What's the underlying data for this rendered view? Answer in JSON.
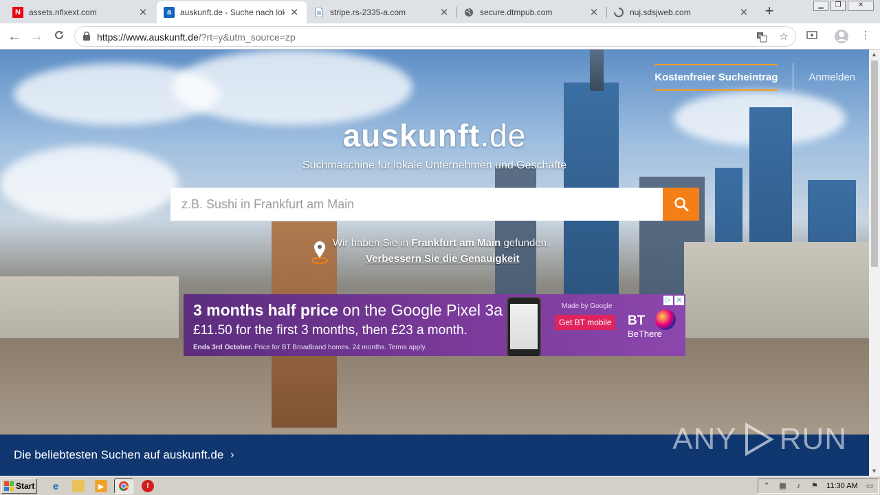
{
  "browser": {
    "tabs": [
      {
        "title": "assets.nflxext.com",
        "favicon": "netflix-icon",
        "active": false
      },
      {
        "title": "auskunft.de - Suche nach lokale",
        "favicon": "auskunft-icon",
        "active": true
      },
      {
        "title": "stripe.rs-2335-a.com",
        "favicon": "document-icon",
        "active": false
      },
      {
        "title": "secure.dtmpub.com",
        "favicon": "globe-icon",
        "active": false
      },
      {
        "title": "nuj.sdsjweb.com",
        "favicon": "loading-icon",
        "active": false
      }
    ],
    "url_host": "https://www.auskunft.de",
    "url_rest": "/?rt=y&utm_source=zp"
  },
  "page": {
    "free_entry": "Kostenfreier Sucheintrag",
    "login": "Anmelden",
    "logo_bold": "auskunft",
    "logo_tld": ".de",
    "tagline": "Suchmaschine für lokale Unternehmen und Geschäfte",
    "search_placeholder": "z.B. Sushi in Frankfurt am Main",
    "location_prefix": "Wir haben Sie in",
    "location_city": "Frankfurt am Main",
    "location_suffix": "gefunden.",
    "improve_accuracy": "Verbessern Sie die Genauigkeit",
    "popular_searches": "Die beliebtesten Suchen auf auskunft.de",
    "accent_color": "#f57f17",
    "band_color": "#10366f"
  },
  "ad": {
    "headline_bold": "3 months half price",
    "headline_rest": "on the Google Pixel 3a",
    "price_line": "£11.50 for the first 3 months, then £23 a month.",
    "fine_bold": "Ends 3rd October.",
    "fine_rest": "Price for BT Broadband homes. 24 months. Terms apply.",
    "made_by": "Made by Google",
    "cta": "Get BT mobile",
    "brand": "BT",
    "brand_slogan": "BeThere"
  },
  "watermark": {
    "left": "ANY",
    "right": "RUN"
  },
  "taskbar": {
    "start_label": "Start",
    "clock": "11:30 AM"
  }
}
